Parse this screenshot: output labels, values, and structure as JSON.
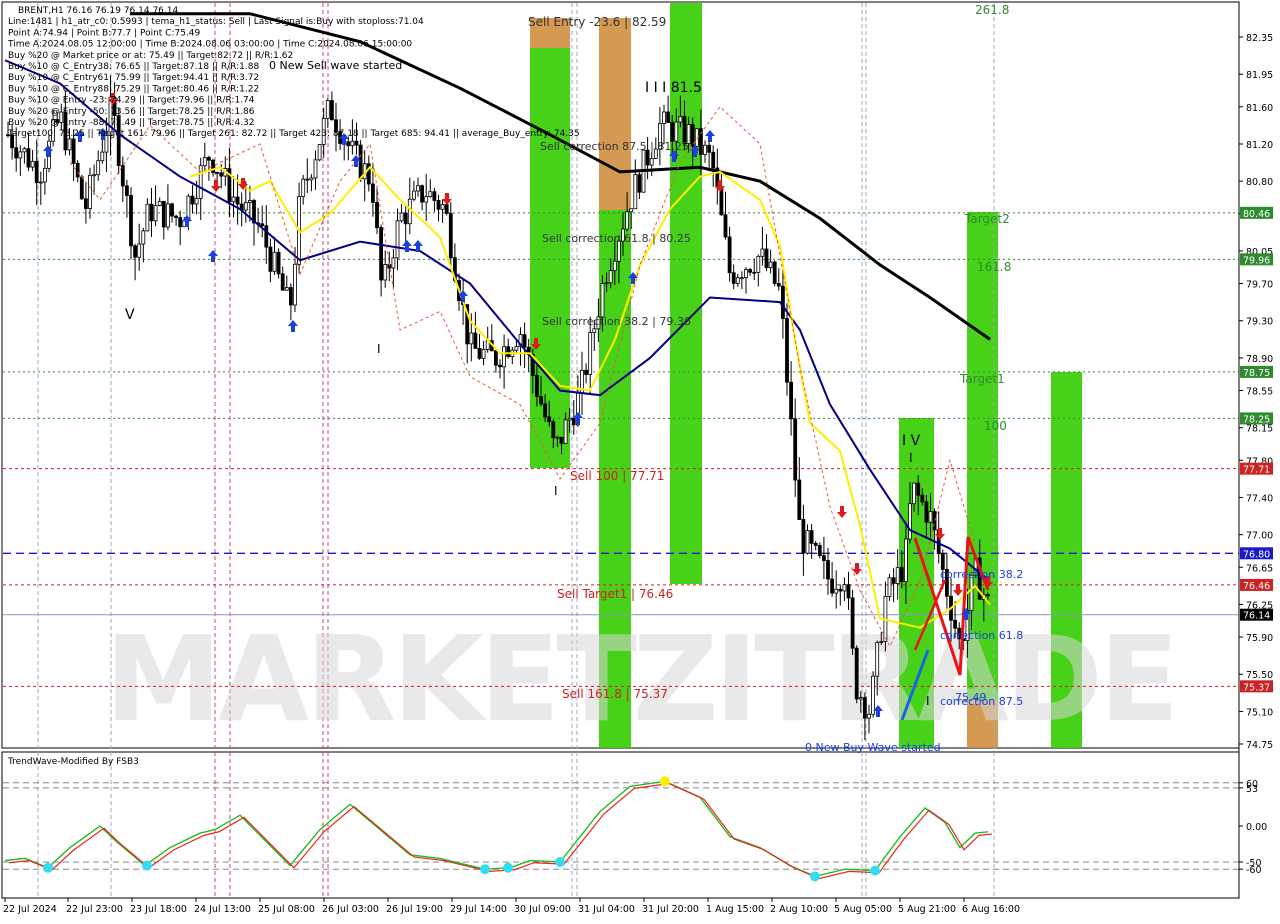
{
  "header": {
    "lines": [
      "BRENT,H1  76.16 76.19 76.14 76.14",
      "Line:1481  |  h1_atr_c0: 0.5993  |  tema_h1_status: Sell  |  Last Signal is:Buy with stoploss:71.04",
      "Point A:74.94  |  Point B:77.7  |  Point C:75.49",
      "Time A:2024.08.05 12:00:00  |  Time B:2024.08.06 03:00:00  |  Time C:2024.08.06 15:00:00",
      "Buy %20 @ Market price or at: 75.49  ||  Target:82.72  ||  R/R:1.62",
      "Buy %10 @ C_Entry38: 76.65  ||  Target:87.18  ||  R/R:1.88",
      "Buy %10 @ C_Entry61: 75.99  ||  Target:94.41  ||  R/R:3.72",
      "Buy %10 @ C_Entry88: 75.29  ||  Target:80.46  ||  R/R:1.22",
      "Buy %10 @ Entry -23: 74.29  ||  Target:79.96  ||  R/R:1.74",
      "Buy %20 @ Entry -50: 73.56  ||  Target:78.25  ||  R/R:1.86",
      "Buy %20 @ Entry -88: 72.49  ||  Target:78.75  ||  R/R:4.32",
      "Target100: 78.25  ||  Target 161: 79.96  ||  Target 261: 82.72  ||  Target 423: 87.18  ||  Target 685: 94.41  ||  average_Buy_entry: 74.35"
    ],
    "wave_note": "0 New Sell wave started"
  },
  "price_axis": {
    "ticks": [
      "82.35",
      "81.95",
      "81.60",
      "81.20",
      "80.80",
      "80.45",
      "80.05",
      "79.70",
      "79.30",
      "78.90",
      "78.55",
      "78.15",
      "77.80",
      "77.40",
      "77.00",
      "76.65",
      "76.25",
      "75.90",
      "75.50",
      "75.10",
      "74.75"
    ],
    "tags": [
      {
        "label": "80.46",
        "color": "#2e8b2e"
      },
      {
        "label": "79.96",
        "color": "#2e8b2e"
      },
      {
        "label": "78.75",
        "color": "#2e8b2e"
      },
      {
        "label": "78.25",
        "color": "#2e8b2e"
      },
      {
        "label": "77.71",
        "color": "#cc2222"
      },
      {
        "label": "76.80",
        "color": "#1a1acc"
      },
      {
        "label": "76.46",
        "color": "#cc2222"
      },
      {
        "label": "76.14",
        "color": "#000000"
      },
      {
        "label": "75.37",
        "color": "#cc2222"
      }
    ]
  },
  "time_axis": {
    "labels": [
      "22 Jul 2024",
      "22 Jul 23:00",
      "23 Jul 18:00",
      "24 Jul 13:00",
      "25 Jul 08:00",
      "26 Jul 03:00",
      "26 Jul 19:00",
      "29 Jul 14:00",
      "30 Jul 09:00",
      "31 Jul 04:00",
      "31 Jul 20:00",
      "1 Aug 15:00",
      "2 Aug 10:00",
      "5 Aug 05:00",
      "5 Aug 21:00",
      "6 Aug 16:00"
    ]
  },
  "annotations": {
    "sell_entry": "Sell Entry -23.6 | 82.59",
    "wave_iii": "I I I 81.5",
    "sell_corr_875": "Sell correction 87.5 | 81.25",
    "sell_corr_618": "Sell correction 61.8 | 80.25",
    "sell_corr_382": "Sell correction 38.2 | 79.36",
    "sell_100": "Sell 100 | 77.71",
    "sell_target1": "Sell Target1 | 76.46",
    "sell_1618": "Sell 161.8 | 75.37",
    "label_2618": "261.8",
    "target2": "Target2",
    "label_1618": "161.8",
    "target1": "Target1",
    "label_100": "100",
    "wave_iv": "I V",
    "wave_v": "V",
    "corr_382": "correction 38.2",
    "corr_618": "correction 61.8",
    "corr_875": "correction 87.5",
    "price_7549": "75.49",
    "new_buy": "0 New Buy Wave started",
    "wave_i_a": "I",
    "wave_i_b": "I",
    "wave_i_c": "I",
    "wave_i_d": "I"
  },
  "watermark": "MARKETZITRADE",
  "indicator": {
    "title": "TrendWave-Modified By FSB3",
    "ticks": [
      "60",
      "53",
      "0.00",
      "-50",
      "-60"
    ]
  },
  "colors": {
    "bull_candle": "#000000",
    "ma_blue": "#000080",
    "ma_yellow": "#ffee00",
    "ma_black": "#000000",
    "green_zone": "#33cc00",
    "orange_zone": "#cc8833",
    "red_level": "#cc2222",
    "green_level": "#2e8b2e",
    "osc_green": "#22bb22",
    "osc_red": "#ee2222"
  },
  "chart_data": {
    "type": "candlestick",
    "symbol": "BRENT",
    "timeframe": "H1",
    "ylim": [
      74.6,
      82.6
    ],
    "levels": [
      {
        "name": "Target2",
        "value": 80.46
      },
      {
        "name": "161.8",
        "value": 79.96
      },
      {
        "name": "Target1",
        "value": 78.75
      },
      {
        "name": "100",
        "value": 78.25
      },
      {
        "name": "Sell 100",
        "value": 77.71
      },
      {
        "name": "blue dashed",
        "value": 76.8
      },
      {
        "name": "Sell Target1",
        "value": 76.46
      },
      {
        "name": "current",
        "value": 76.14
      },
      {
        "name": "Sell 161.8",
        "value": 75.37
      }
    ],
    "oscillator_ylim": [
      -80,
      80
    ]
  }
}
